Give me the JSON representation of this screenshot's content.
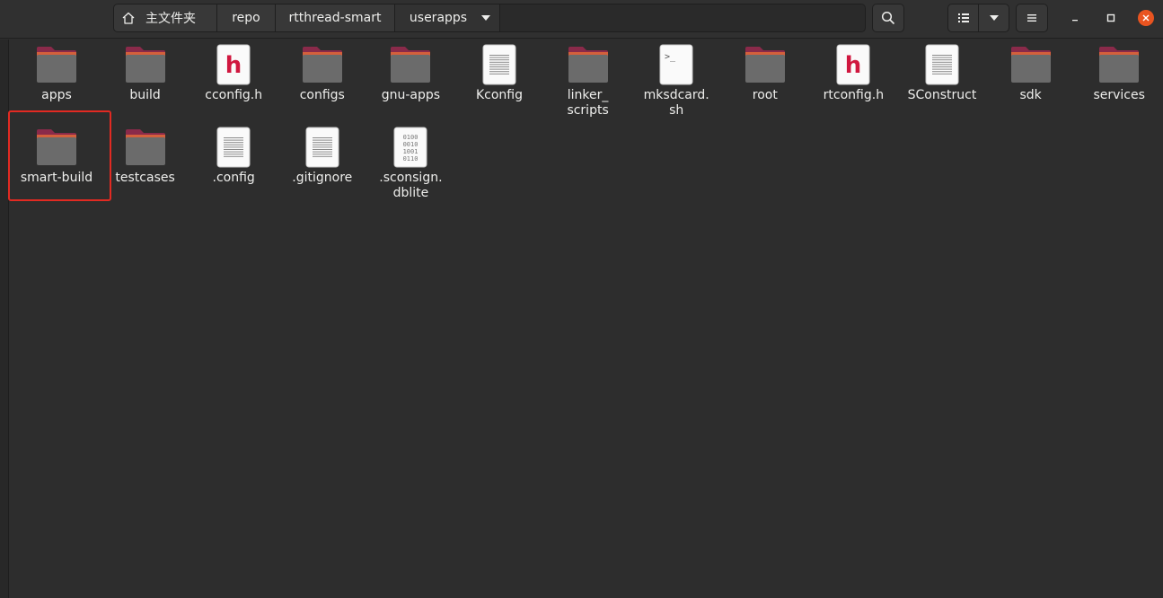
{
  "pathbar": {
    "home_label": "主文件夹",
    "crumbs": [
      "repo",
      "rtthread-smart",
      "userapps"
    ]
  },
  "icons": {
    "home": "home-icon",
    "search": "search-icon",
    "list_view": "list-view-icon",
    "view_options": "chevron-down-icon",
    "menu": "hamburger-menu-icon",
    "minimize": "minimize-icon",
    "maximize": "maximize-icon",
    "close": "close-icon"
  },
  "colors": {
    "folder_body": "#6b6b6b",
    "folder_tab": "#8a2a4a",
    "header_accent": "#e95420",
    "selection_outline": "#e22a22"
  },
  "items": [
    {
      "name": "apps",
      "type": "folder"
    },
    {
      "name": "build",
      "type": "folder"
    },
    {
      "name": "cconfig.h",
      "type": "header"
    },
    {
      "name": "configs",
      "type": "folder"
    },
    {
      "name": "gnu-apps",
      "type": "folder"
    },
    {
      "name": "Kconfig",
      "type": "text"
    },
    {
      "name": "linker_\nscripts",
      "type": "folder"
    },
    {
      "name": "mksdcard.\nsh",
      "type": "script"
    },
    {
      "name": "root",
      "type": "folder"
    },
    {
      "name": "rtconfig.h",
      "type": "header"
    },
    {
      "name": "SConstruct",
      "type": "text"
    },
    {
      "name": "sdk",
      "type": "folder"
    },
    {
      "name": "services",
      "type": "folder"
    },
    {
      "name": "smart-build",
      "type": "folder",
      "selected": true
    },
    {
      "name": "testcases",
      "type": "folder"
    },
    {
      "name": ".config",
      "type": "text"
    },
    {
      "name": ".gitignore",
      "type": "text"
    },
    {
      "name": ".sconsign.\ndblite",
      "type": "binary"
    }
  ]
}
